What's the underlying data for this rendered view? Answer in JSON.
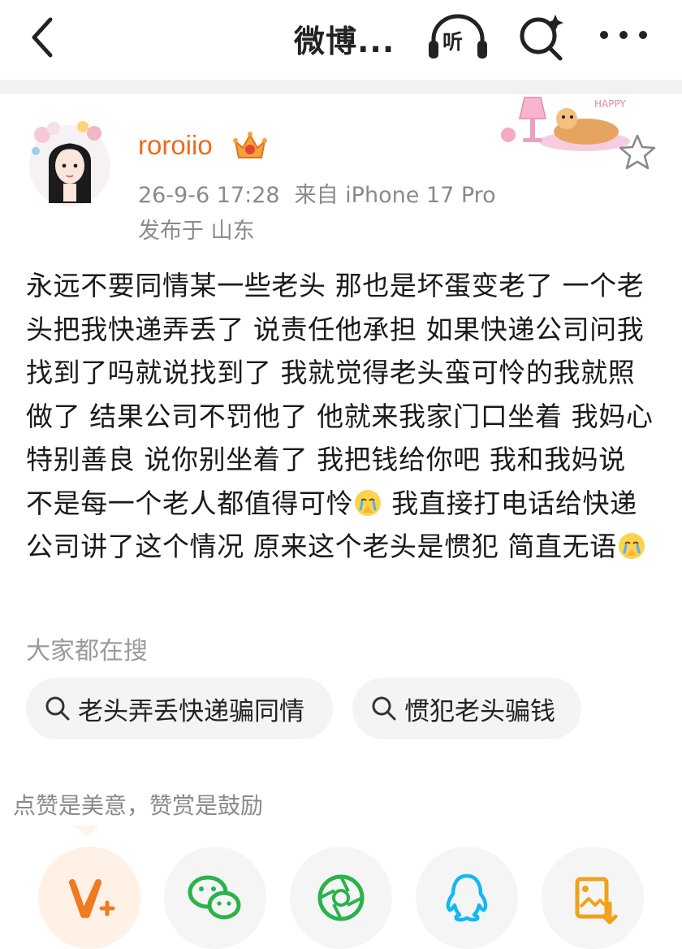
{
  "header": {
    "title": "微博...",
    "listen_label": "听"
  },
  "post": {
    "author": {
      "name": "roroiio"
    },
    "timestamp": "26-9-6 17:28",
    "source": "来自 iPhone 17 Pro",
    "location": "发布于 山东",
    "text_segments": [
      "永远不要同情某一些老头 那也是坏蛋变老了 一个老头把我快递弄丢了 说责任他承担 如果快递公司问我找到了吗就说找到了 我就觉得老头蛮可怜的我就照做了 结果公司不罚他了 他就来我家门口坐着 我妈心特别善良 说你别坐着了 我把钱给你吧 我和我妈说 不是每一个老人都值得可怜",
      " 我直接打电话给快递公司讲了这个情况 原来这个老头是惯犯 简直无语"
    ],
    "emoji_names": [
      "pray-cry-emoji",
      "pray-cry-emoji"
    ]
  },
  "trending_search": {
    "label": "大家都在搜",
    "chips": [
      "老头弄丢快递骗同情",
      "惯犯老头骗钱"
    ]
  },
  "share_panel": {
    "hint": "点赞是美意，赞赏是鼓励",
    "items": [
      "reward-icon",
      "wechat-icon",
      "moments-icon",
      "qq-icon",
      "save-image-icon"
    ]
  },
  "colors": {
    "accent": "#ee6a1c",
    "wechat": "#2bb24c",
    "qq": "#12b7f5"
  }
}
